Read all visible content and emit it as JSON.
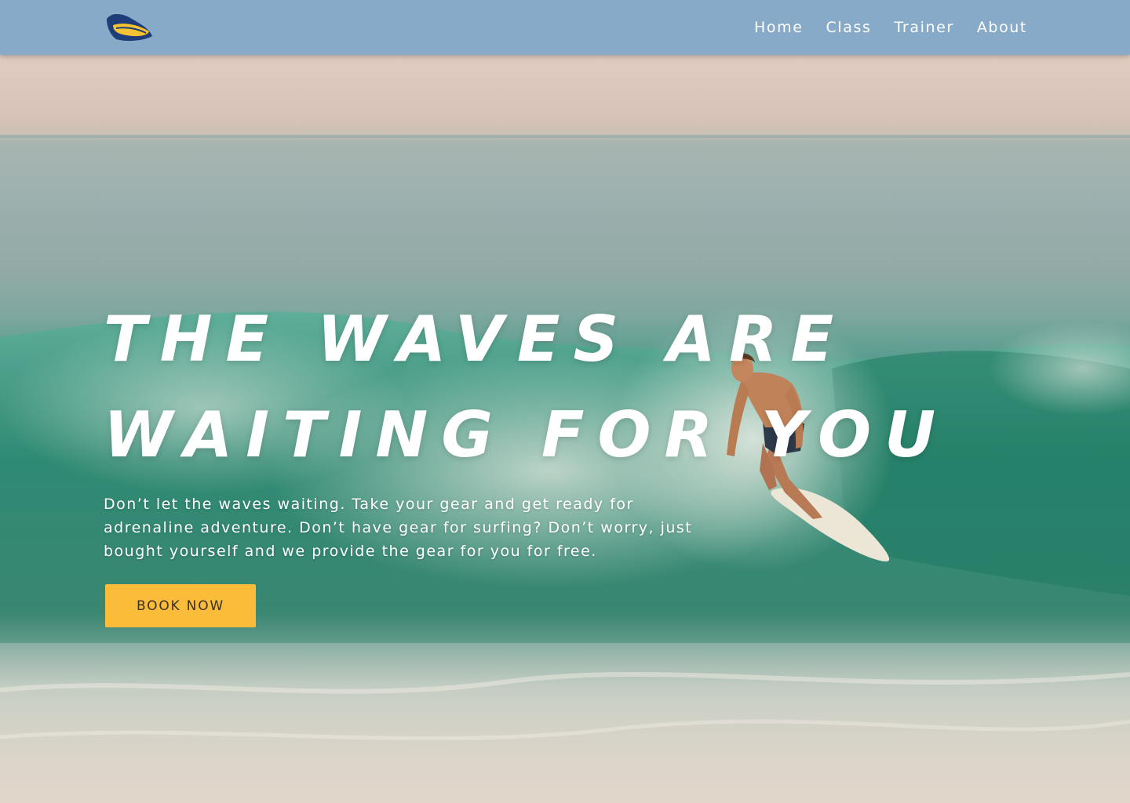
{
  "nav": {
    "logo_icon": "surf-helmet-logo-icon",
    "links": [
      "Home",
      "Class",
      "Trainer",
      "About"
    ]
  },
  "hero": {
    "headline_line1": "THE WAVES ARE",
    "headline_line2": "WAITING FOR YOU",
    "description": "Don’t let the waves waiting. Take your gear and get ready for adrenaline adventure. Don’t have gear for surfing? Don’t worry, just bought yourself and we provide the gear for you for free.",
    "button_label": "BOOK NOW",
    "background": "surfer-riding-wave-photo"
  },
  "colors": {
    "nav_bg": "#86aac8",
    "button_bg": "#fbbc3a",
    "logo_dark": "#1f3d78",
    "logo_yellow": "#f6c232"
  }
}
